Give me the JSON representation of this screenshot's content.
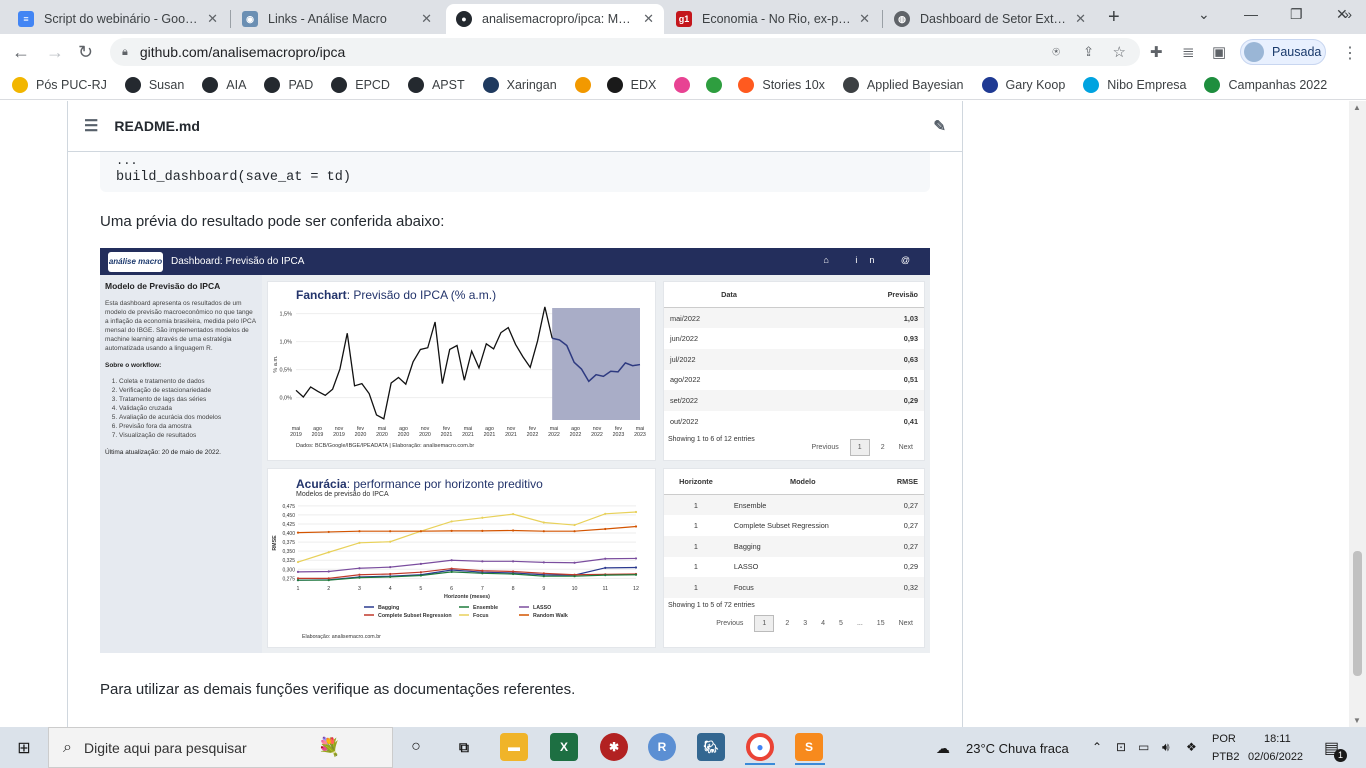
{
  "tabs": [
    {
      "title": "Script do webinário - Google",
      "color": "#4285f4",
      "glyph": "≡"
    },
    {
      "title": "Links - Análise Macro",
      "color": "#6b8fb3",
      "glyph": "◉"
    },
    {
      "title": "analisemacropro/ipca: Model",
      "color": "#24292f",
      "glyph": "●"
    },
    {
      "title": "Economia - No Rio, ex-presid",
      "color": "#c4161c",
      "glyph": "g1"
    },
    {
      "title": "Dashboard de Setor Externo",
      "color": "#5f6368",
      "glyph": "◍"
    }
  ],
  "url": "github.com/analisemacropro/ipca",
  "profile_label": "Pausada",
  "bookmarks": [
    {
      "label": "Pós PUC-RJ",
      "color": "#f2b600"
    },
    {
      "label": "Susan",
      "color": "#24292f"
    },
    {
      "label": "AIA",
      "color": "#24292f"
    },
    {
      "label": "PAD",
      "color": "#24292f"
    },
    {
      "label": "EPCD",
      "color": "#24292f"
    },
    {
      "label": "APST",
      "color": "#24292f"
    },
    {
      "label": "Xaringan",
      "color": "#1f3a5f"
    },
    {
      "label": "",
      "color": "#f29900"
    },
    {
      "label": "EDX",
      "color": "#1a1a1a"
    },
    {
      "label": "",
      "color": "#e84393"
    },
    {
      "label": "",
      "color": "#2e9e3f"
    },
    {
      "label": "Stories 10x",
      "color": "#ff5a1f"
    },
    {
      "label": "Applied Bayesian",
      "color": "#3c4043"
    },
    {
      "label": "Gary Koop",
      "color": "#1f3a93"
    },
    {
      "label": "Nibo Empresa",
      "color": "#00a3e0"
    },
    {
      "label": "Campanhas 2022",
      "color": "#1e8e3e"
    }
  ],
  "readme": {
    "filename": "README.md",
    "code_top": "...",
    "code_line": "build_dashboard(save_at = td)",
    "preview_text": "Uma prévia do resultado pode ser conferida abaixo:",
    "footer_text": "Para utilizar as demais funções verifique as documentações referentes."
  },
  "dashboard": {
    "header_title": "Dashboard: Previsão do IPCA",
    "logo_text": "análise macro",
    "sidebar": {
      "title": "Modelo de Previsão do IPCA",
      "intro": "Esta dashboard apresenta os resultados de um modelo de previsão macroeconômico no que tange a inflação da economia brasileira, medida pelo IPCA mensal do IBGE. São implementados modelos de machine learning através de uma estratégia automatizada usando a linguagem R.",
      "workflow_title": "Sobre o workflow:",
      "workflow": [
        "Coleta e tratamento de dados",
        "Verificação de estacionariedade",
        "Tratamento de lags das séries",
        "Validação cruzada",
        "Avaliação de acurácia dos modelos",
        "Previsão fora da amostra",
        "Visualização de resultados"
      ],
      "updated": "Última atualização: 20 de maio de 2022."
    },
    "fanchart": {
      "title_bold": "Fanchart",
      "title_rest": ": Previsão do IPCA (% a.m.)",
      "source": "Dados: BCB/Google/IBGE/IPEADATA | Elaboração: analisemacro.com.br"
    },
    "forecast_table": {
      "headers": [
        "Data",
        "Previsão"
      ],
      "rows": [
        [
          "mai/2022",
          "1,03"
        ],
        [
          "jun/2022",
          "0,93"
        ],
        [
          "jul/2022",
          "0,63"
        ],
        [
          "ago/2022",
          "0,51"
        ],
        [
          "set/2022",
          "0,29"
        ],
        [
          "out/2022",
          "0,41"
        ]
      ],
      "info": "Showing 1 to 6 of 12 entries",
      "pager": [
        "Previous",
        "1",
        "2",
        "Next"
      ]
    },
    "accuracy": {
      "title_bold": "Acurácia",
      "title_rest": ": performance por horizonte preditivo",
      "subtitle": "Modelos de previsão do IPCA",
      "source": "Elaboração: analisemacro.com.br"
    },
    "accuracy_table": {
      "headers": [
        "Horizonte",
        "Modelo",
        "RMSE"
      ],
      "rows": [
        [
          "1",
          "Ensemble",
          "0,27"
        ],
        [
          "1",
          "Complete Subset Regression",
          "0,27"
        ],
        [
          "1",
          "Bagging",
          "0,27"
        ],
        [
          "1",
          "LASSO",
          "0,29"
        ],
        [
          "1",
          "Focus",
          "0,32"
        ]
      ],
      "info": "Showing 1 to 5 of 72 entries",
      "pager": [
        "Previous",
        "1",
        "2",
        "3",
        "4",
        "5",
        "...",
        "15",
        "Next"
      ]
    }
  },
  "chart_data": [
    {
      "type": "line",
      "title": "Fanchart: Previsão do IPCA (% a.m.)",
      "ylabel": "% a.m.",
      "xlabel": "",
      "ylim": [
        -0.4,
        1.6
      ],
      "yticks": [
        "0,0%",
        "0,5%",
        "1,0%",
        "1,5%"
      ],
      "xticks": [
        "mai 2019",
        "ago 2019",
        "nov 2019",
        "fev 2020",
        "mai 2020",
        "ago 2020",
        "nov 2020",
        "fev 2021",
        "mai 2021",
        "ago 2021",
        "nov 2021",
        "fev 2022",
        "mai 2022",
        "ago 2022",
        "nov 2022",
        "fev 2023",
        "mai 2023"
      ],
      "series": [
        {
          "values": [
            0.13,
            0.01,
            0.19,
            0.11,
            0.04,
            0.15,
            0.51,
            1.15,
            0.21,
            0.25,
            0.07,
            -0.31,
            -0.38,
            0.26,
            0.36,
            0.24,
            0.64,
            0.86,
            0.89,
            1.35,
            0.25,
            0.86,
            0.93,
            0.31,
            0.83,
            0.53,
            0.96,
            0.87,
            1.16,
            1.25,
            0.95,
            0.73,
            0.54,
            1.01,
            1.62,
            1.06
          ],
          "color": "#111111"
        },
        {
          "values": [
            1.06,
            1.03,
            0.93,
            0.63,
            0.51,
            0.29,
            0.41,
            0.38,
            0.47,
            0.46,
            0.62,
            0.57,
            0.59
          ],
          "color": "#2e3a80"
        }
      ],
      "forecast_shade_start_index": 35
    },
    {
      "type": "line",
      "title": "Acurácia: performance por horizonte preditivo",
      "subtitle": "Modelos de previsão do IPCA",
      "xlabel": "Horizonte (meses)",
      "ylabel": "RMSE",
      "ylim": [
        0.265,
        0.48
      ],
      "x": [
        1,
        2,
        3,
        4,
        5,
        6,
        7,
        8,
        9,
        10,
        11,
        12
      ],
      "yticks": [
        "0,275",
        "0,300",
        "0,325",
        "0,350",
        "0,375",
        "0,400",
        "0,425",
        "0,450",
        "0,475"
      ],
      "series": [
        {
          "name": "Bagging",
          "color": "#2b3a8f",
          "values": [
            0.27,
            0.271,
            0.279,
            0.281,
            0.285,
            0.298,
            0.292,
            0.29,
            0.285,
            0.284,
            0.304,
            0.305
          ]
        },
        {
          "name": "Complete Subset Regression",
          "color": "#c0392b",
          "values": [
            0.275,
            0.275,
            0.285,
            0.287,
            0.292,
            0.302,
            0.296,
            0.294,
            0.289,
            0.285,
            0.286,
            0.287
          ]
        },
        {
          "name": "Ensemble",
          "color": "#1e7a3c",
          "values": [
            0.27,
            0.27,
            0.277,
            0.279,
            0.283,
            0.293,
            0.289,
            0.287,
            0.281,
            0.281,
            0.284,
            0.285
          ]
        },
        {
          "name": "Focus",
          "color": "#e8d15a",
          "values": [
            0.32,
            0.347,
            0.373,
            0.376,
            0.405,
            0.432,
            0.442,
            0.452,
            0.429,
            0.422,
            0.453,
            0.458
          ]
        },
        {
          "name": "LASSO",
          "color": "#7a4d9e",
          "values": [
            0.293,
            0.294,
            0.303,
            0.306,
            0.315,
            0.325,
            0.322,
            0.322,
            0.319,
            0.318,
            0.329,
            0.33
          ]
        },
        {
          "name": "Random Walk",
          "color": "#d35400",
          "values": [
            0.401,
            0.403,
            0.405,
            0.405,
            0.405,
            0.406,
            0.406,
            0.407,
            0.405,
            0.405,
            0.411,
            0.418
          ]
        }
      ]
    }
  ],
  "taskbar": {
    "search_placeholder": "Digite aqui para pesquisar",
    "weather": "23°C  Chuva fraca",
    "lang1": "POR",
    "lang2": "PTB2",
    "time": "18:11",
    "date": "02/06/2022",
    "notif_count": "1"
  }
}
